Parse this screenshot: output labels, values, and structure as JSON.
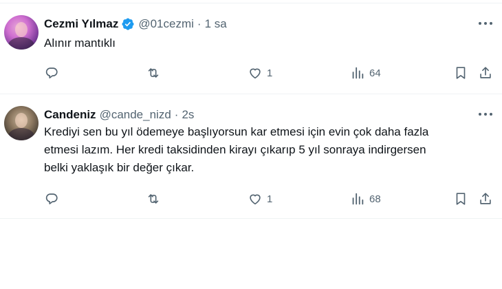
{
  "tweets": [
    {
      "author": {
        "name": "Cezmi Yılmaz",
        "handle": "@01cezmi",
        "verified": true
      },
      "separator": "·",
      "time": "1 sa",
      "text_lines": [
        "Alınır mantıklı"
      ],
      "stats": {
        "reply": "",
        "retweet": "",
        "like": "1",
        "views": "64"
      },
      "icons": [
        "reply-icon",
        "retweet-icon",
        "like-icon",
        "views-icon",
        "bookmark-icon",
        "share-icon",
        "more-icon"
      ]
    },
    {
      "author": {
        "name": "Candeniz",
        "handle": "@cande_nizd",
        "verified": false
      },
      "separator": "·",
      "time": "2s",
      "text_lines": [
        "Krediyi sen bu yıl ödemeye başlıyorsun kar etmesi için evin çok daha fazla",
        "etmesi lazım. Her kredi taksidinden kirayı çıkarıp 5 yıl sonraya indirgersen",
        "belki yaklaşık bir değer çıkar."
      ],
      "stats": {
        "reply": "",
        "retweet": "",
        "like": "1",
        "views": "68"
      },
      "icons": [
        "reply-icon",
        "retweet-icon",
        "like-icon",
        "views-icon",
        "bookmark-icon",
        "share-icon",
        "more-icon"
      ]
    }
  ],
  "colors": {
    "text": "#0f1419",
    "muted": "#536471",
    "verified": "#1d9bf0",
    "divider": "#eff3f4"
  }
}
